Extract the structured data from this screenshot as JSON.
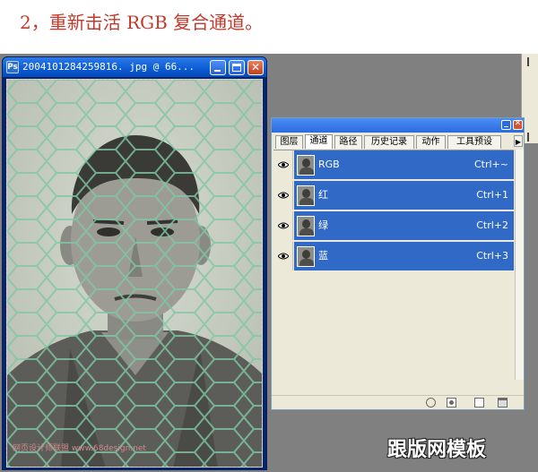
{
  "heading": "2，重新击活 RGB 复合通道。",
  "document_window": {
    "title": "2004101284259816. jpg @ 66...",
    "app_icon_letter": "Ps"
  },
  "panel": {
    "tabs": [
      "图层",
      "通道",
      "路径",
      "历史记录",
      "动作",
      "工具预设"
    ],
    "active_tab": "通道",
    "channels": [
      {
        "name": "RGB",
        "shortcut": "Ctrl+~",
        "visible": true,
        "selected": true
      },
      {
        "name": "红",
        "shortcut": "Ctrl+1",
        "visible": true,
        "selected": true
      },
      {
        "name": "绿",
        "shortcut": "Ctrl+2",
        "visible": true,
        "selected": true
      },
      {
        "name": "蓝",
        "shortcut": "Ctrl+3",
        "visible": true,
        "selected": true
      }
    ],
    "selection_color": "#3169c6"
  },
  "watermarks": {
    "left": "网页设计师联盟 www.68design.net",
    "right": "跟版网模板"
  },
  "colors": {
    "heading": "#c0392b",
    "workspace": "#808080",
    "titlebar": "#0a5bd6"
  }
}
